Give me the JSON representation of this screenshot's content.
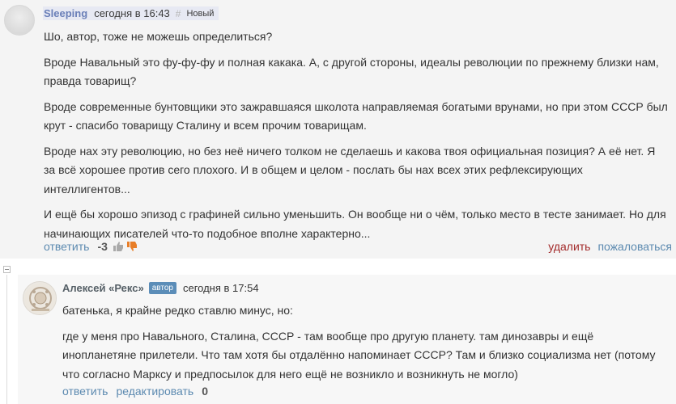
{
  "comments": [
    {
      "author": "Sleeping",
      "time": "сегодня в 16:43",
      "hash": "#",
      "new_label": "Новый",
      "paragraphs": [
        "Шо, автор, тоже не можешь определиться?",
        "Вроде Навальный это фу-фу-фу и полная какака. А, с другой стороны, идеалы революции по прежнему близки нам, правда товарищ?",
        "Вроде современные бунтовщики это зажравшаяся школота направляемая богатыми врунами, но при этом СССР был крут - спасибо товарищу Сталину и всем прочим товарищам.",
        "Вроде нах эту революцию, но без неё ничего толком не сделаешь и какова твоя официальная позиция? А её нет. Я за всё хорошее против сего плохого. И в общем и целом - послать бы нах всех этих рефлексирующих интеллигентов...",
        "И ещё бы хорошо эпизод с графиней сильно уменьшить. Он вообще ни о чём, только место в тесте занимает. Но для начинающих писателей что-то подобное вполне характерно..."
      ],
      "actions": {
        "reply": "ответить",
        "score": "-3",
        "delete": "удалить",
        "report": "пожаловаться"
      }
    },
    {
      "author": "Алексей «Рекс»",
      "badge": "автор",
      "time": "сегодня в 17:54",
      "paragraphs": [
        "батенька, я крайне редко ставлю минус, но:",
        "где у меня про Навального, Сталина, СССР - там вообще про другую планету. там динозавры и ещё инопланетяне прилетели. Что там хотя бы отдалённо напоминает СССР? Там и близко социализма нет (потому что согласно Марксу и предпосылок для него ещё не возникло и возникнуть не могло)"
      ],
      "actions": {
        "reply": "ответить",
        "edit": "редактировать",
        "score": "0"
      }
    }
  ],
  "icons": {
    "thumb_up": "thumb-up-icon",
    "thumb_down": "thumb-down-icon",
    "collapse": "minus-icon"
  },
  "colors": {
    "link": "#5c8ab0",
    "delete": "#a32b2b",
    "vote_down": "#e87e28",
    "author_badge": "#5b8db8"
  }
}
